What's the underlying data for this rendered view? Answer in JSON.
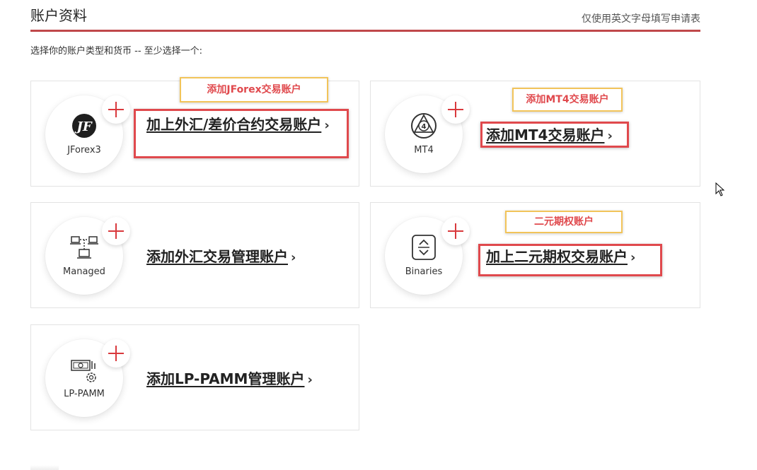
{
  "header": {
    "title": "账户资料",
    "note": "仅使用英文字母填写申请表"
  },
  "subtitle": "选择你的账户类型和货币 -- 至少选择一个:",
  "cards": {
    "jforex": {
      "logo_label": "JForex3",
      "icon": "jforex-logo-icon",
      "action_label": "加上外汇/差价合约交易账户",
      "callout": "添加JForex交易账户"
    },
    "mt4": {
      "logo_label": "MT4",
      "icon": "mt4-logo-icon",
      "action_label": "添加MT4交易账户",
      "callout": "添加MT4交易账户"
    },
    "managed": {
      "logo_label": "Managed",
      "icon": "network-computers-icon",
      "action_label": "添加外汇交易管理账户"
    },
    "binaries": {
      "logo_label": "Binaries",
      "icon": "up-down-chevron-icon",
      "action_label": "加上二元期权交易账户",
      "callout": "二元期权账户"
    },
    "lppamm": {
      "logo_label": "LP-PAMM",
      "icon": "money-gear-icon",
      "action_label": "添加LP-PAMM管理账户"
    }
  },
  "chevron": "›",
  "colors": {
    "accent_red": "#d9393d",
    "rule": "#c0484a",
    "callout_border": "#f2c45a"
  }
}
